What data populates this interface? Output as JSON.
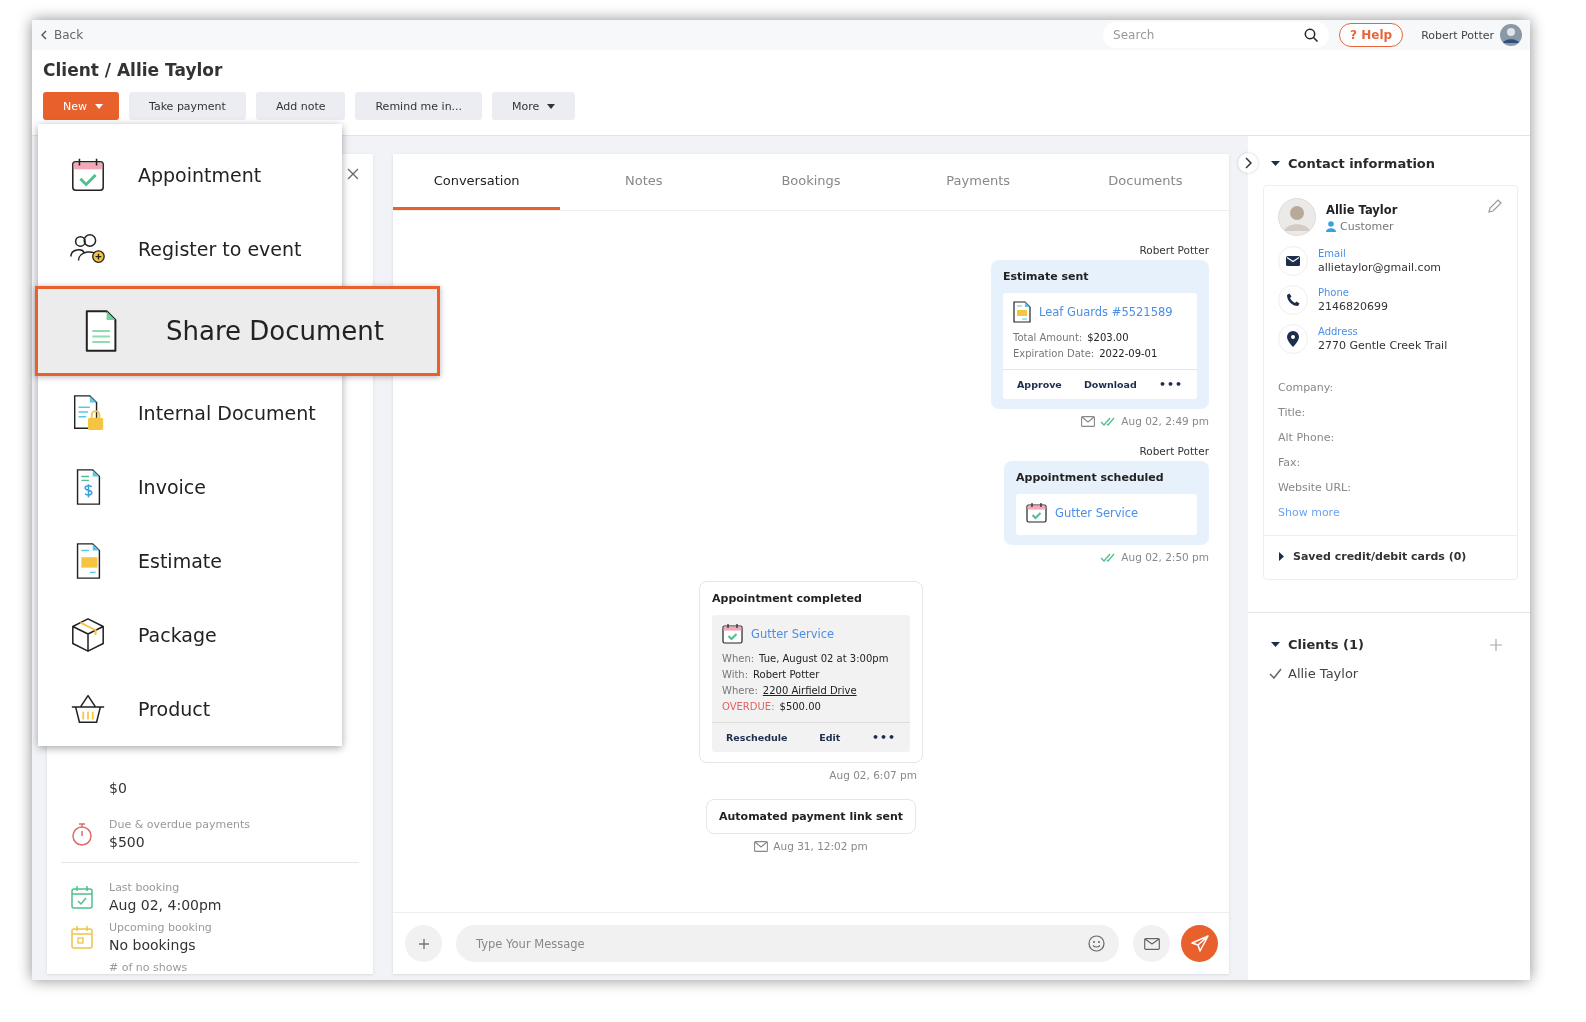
{
  "topbar": {
    "back": "Back",
    "search": {
      "placeholder": "Search"
    },
    "help_mark": "?",
    "help": "Help",
    "user": "Robert Potter"
  },
  "title": "Client / Allie Taylor",
  "actions": [
    {
      "label": "New",
      "kind": "primary"
    },
    {
      "label": "Take payment",
      "kind": "plain"
    },
    {
      "label": "Add note",
      "kind": "plain"
    },
    {
      "label": "Remind me in...",
      "kind": "plain"
    },
    {
      "label": "More",
      "kind": "dropdown"
    }
  ],
  "new_menu": [
    {
      "label": "Appointment",
      "kind": "calendar",
      "selected": false
    },
    {
      "label": "Register to event",
      "kind": "people",
      "selected": false
    },
    {
      "label": "Share Document",
      "kind": "document",
      "selected": true
    },
    {
      "label": "Internal Document",
      "kind": "locked",
      "selected": false
    },
    {
      "label": "Invoice",
      "kind": "invoice",
      "selected": false
    },
    {
      "label": "Estimate",
      "kind": "estimate",
      "selected": false
    },
    {
      "label": "Package",
      "kind": "package",
      "selected": false
    },
    {
      "label": "Product",
      "kind": "basket",
      "selected": false
    }
  ],
  "left_panel": {
    "stats": [
      {
        "kind": "partial",
        "value": "$0"
      },
      {
        "kind": "due",
        "label": "Due & overdue payments",
        "value": "$500"
      },
      {
        "kind": "last",
        "label": "Last booking",
        "value": "Aug 02, 4:00pm"
      },
      {
        "kind": "upcoming",
        "label": "Upcoming booking",
        "value": "No bookings"
      },
      {
        "kind": "noshow",
        "label": "# of no shows"
      }
    ]
  },
  "tabs": [
    {
      "label": "Conversation",
      "selected": true
    },
    {
      "label": "Notes",
      "selected": false
    },
    {
      "label": "Bookings",
      "selected": false
    },
    {
      "label": "Payments",
      "selected": false
    },
    {
      "label": "Documents",
      "selected": false
    }
  ],
  "messages": [
    {
      "kind": "estimate",
      "sender": "Robert Potter",
      "title": "Estimate sent",
      "link": "Leaf Guards #5521589",
      "fields": [
        {
          "kind": "plain",
          "label": "Total Amount:",
          "value": "$203.00"
        },
        {
          "kind": "plain",
          "label": "Expiration Date:",
          "value": "2022-09-01"
        }
      ],
      "actions": [
        "Approve",
        "Download"
      ],
      "more": "•••",
      "time": "Aug 02, 2:49 pm",
      "emailed": true,
      "read": true
    },
    {
      "kind": "scheduled",
      "sender": "Robert Potter",
      "title": "Appointment scheduled",
      "link": "Gutter Service",
      "time": "Aug 02, 2:50 pm",
      "emailed": false,
      "read": true
    },
    {
      "kind": "completed",
      "title": "Appointment completed",
      "link": "Gutter Service",
      "fields": [
        {
          "kind": "plain",
          "label": "When:",
          "value": "Tue, August 02 at 3:00pm"
        },
        {
          "kind": "plain",
          "label": "With:",
          "value": "Robert Potter"
        },
        {
          "kind": "address",
          "label": "Where:",
          "value": "2200 Airfield Drive"
        },
        {
          "kind": "alert",
          "label": "OVERDUE:",
          "value": "$500.00"
        }
      ],
      "actions": [
        "Reschedule",
        "Edit"
      ],
      "more": "•••",
      "time": "Aug 02, 6:07 pm",
      "emailed": false,
      "read": false
    },
    {
      "kind": "note",
      "title": "Automated payment link sent",
      "time": "Aug 31, 12:02 pm",
      "emailed": true,
      "read": false
    }
  ],
  "composer": {
    "placeholder": "Type Your Message"
  },
  "contact": {
    "heading": "Contact information",
    "expanded": true,
    "name": "Allie Taylor",
    "role": "Customer",
    "fields": [
      {
        "kind": "email",
        "label": "Email",
        "value": "allietaylor@gmail.com"
      },
      {
        "kind": "phone",
        "label": "Phone",
        "value": "2146820699"
      },
      {
        "kind": "address",
        "label": "Address",
        "value": "2770 Gentle Creek Trail"
      }
    ],
    "extra": [
      "Company:",
      "Title:",
      "Alt Phone:",
      "Fax:",
      "Website URL:"
    ],
    "show_more": "Show more",
    "cards": {
      "label": "Saved credit/debit cards (0)",
      "expanded": false
    }
  },
  "clients": {
    "heading": "Clients (1)",
    "expanded": true,
    "items": [
      {
        "name": "Allie Taylor",
        "checked": true
      }
    ]
  }
}
